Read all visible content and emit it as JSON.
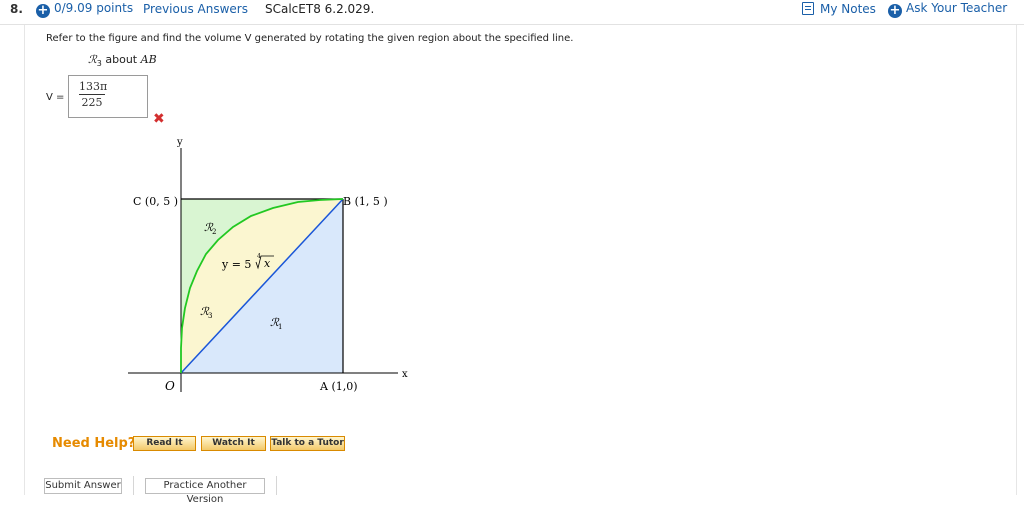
{
  "header": {
    "question_number": "8.",
    "points": "0/9.09 points",
    "previous_answers": "Previous Answers",
    "question_id": "SCalcET8 6.2.029.",
    "my_notes": "My Notes",
    "ask_teacher": "Ask Your Teacher"
  },
  "problem": {
    "text": "Refer to the figure and find the volume V generated by rotating the given region about the specified line.",
    "region": "ℛ",
    "region_sub": "3",
    "about": "about",
    "line": "AB"
  },
  "answer": {
    "label": "V =",
    "numerator": "133π",
    "denominator": "225",
    "status": "incorrect"
  },
  "figure": {
    "y_axis": "y",
    "x_axis": "x",
    "point_c": "C (0, 5 )",
    "point_b": "B (1, 5 )",
    "point_o": "O",
    "point_a": "A (1,0)",
    "curve_label_lhs": "y = 5",
    "curve_label_rad": "x",
    "curve_label_idx": "4",
    "r1": "ℛ",
    "r1_sub": "1",
    "r2": "ℛ",
    "r2_sub": "2",
    "r3": "ℛ",
    "r3_sub": "3",
    "colors": {
      "r1_fill": "#d9e8fb",
      "r2_fill": "#d9f5d2",
      "r3_fill": "#fbf6d0",
      "curve": "#22c822",
      "diagonal": "#1a56d8",
      "box": "#000000"
    }
  },
  "help": {
    "need_help": "Need Help?",
    "read_it": "Read It",
    "watch_it": "Watch It",
    "talk_tutor": "Talk to a Tutor"
  },
  "actions": {
    "submit": "Submit Answer",
    "practice": "Practice Another Version"
  }
}
